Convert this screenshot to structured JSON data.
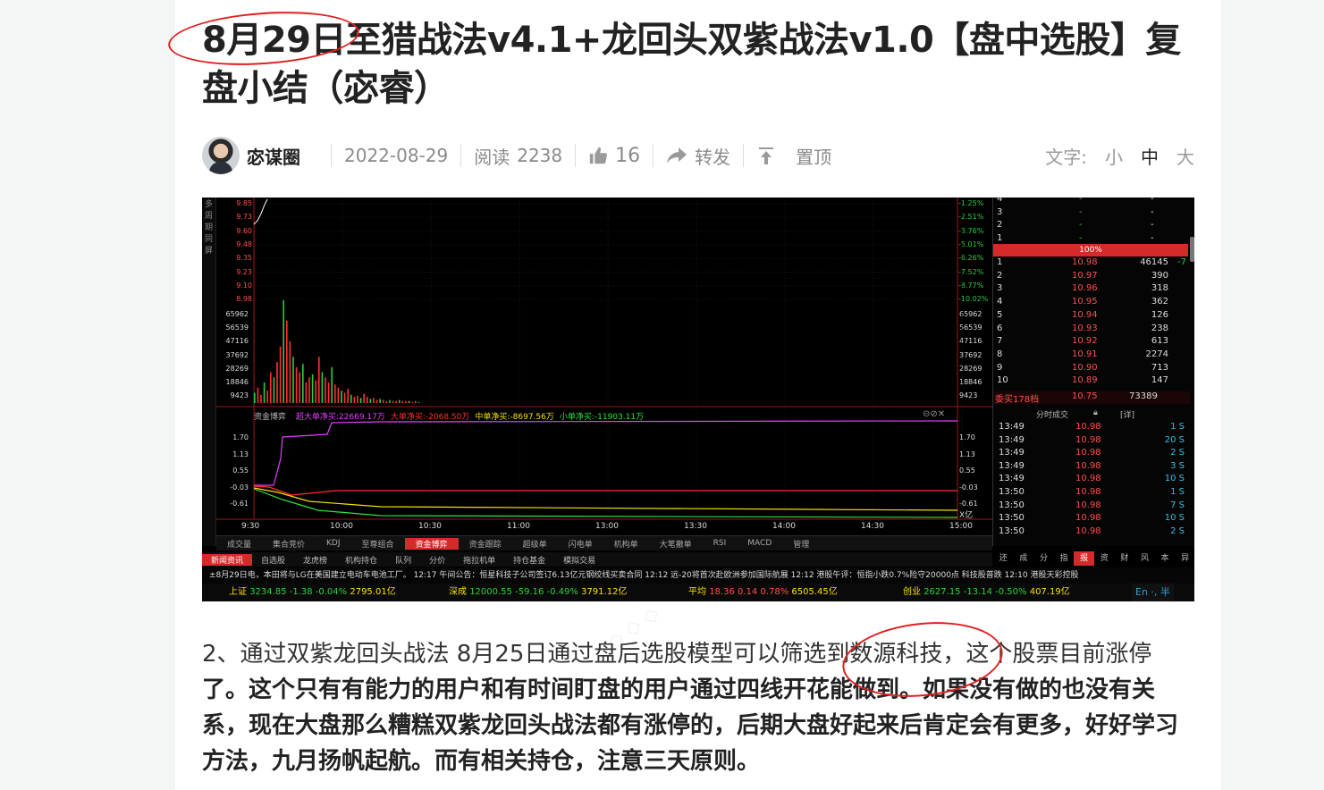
{
  "article": {
    "title": "8月29日至猎战法v4.1+龙回头双紫战法v1.0【盘中选股】复盘小结（宓睿）",
    "author": "宓谋圈",
    "date": "2022-08-29",
    "read_label": "阅读",
    "read_count": "2238",
    "like_count": "16",
    "share_label": "转发",
    "pin_label": "置顶",
    "font_label": "文字:",
    "font_small": "小",
    "font_medium": "中",
    "font_large": "大",
    "para_normal": "2、通过双紫龙回头战法 8月25日通过盘后选股模型可以筛选到数源科技，这个股票目前涨停",
    "para_bold": "了。这个只有有能力的用户和有时间盯盘的用户通过四线开花能做到。如果没有做的也没有关系，现在大盘那么糟糕双紫龙回头战法都有涨停的，后期大盘好起来后肯定会有更多，好好学习方法，九月扬帆起航。而有相关持仓，注意三天原则。"
  },
  "chart": {
    "sidebar_text": "多周期同屏",
    "price_labels": [
      "9.85",
      "9.73",
      "9.60",
      "9.48",
      "9.35",
      "9.23",
      "9.10",
      "8.98"
    ],
    "pct_labels": [
      "-1.25%",
      "-2.51%",
      "-3.76%",
      "-5.01%",
      "-6.26%",
      "-7.52%",
      "-8.77%",
      "-10.02%"
    ],
    "vol_labels": [
      "65962",
      "56539",
      "47116",
      "37692",
      "28269",
      "18846",
      "9423"
    ],
    "fund_panel_title": "资金博弈",
    "fund_legend": [
      {
        "label": "超大单净买:22669.17万",
        "color": "#e040fb"
      },
      {
        "label": "大单净买:-2068.50万",
        "color": "#ff3030"
      },
      {
        "label": "中单净买:-8697.56万",
        "color": "#f5e000"
      },
      {
        "label": "小单净买:-11903.11万",
        "color": "#30e040"
      }
    ],
    "fund_axis": [
      "1.70",
      "1.13",
      "0.55",
      "-0.03",
      "-0.61"
    ],
    "fund_unit": "X亿",
    "time_labels": [
      "9:30",
      "10:00",
      "10:30",
      "11:00",
      "13:00",
      "13:30",
      "14:00",
      "14:30",
      "15:00"
    ],
    "bottom_tabs": [
      "成交量",
      "集合竞价",
      "KDJ",
      "至尊组合",
      "资金博弈",
      "资金跟踪",
      "超级单",
      "闪电单",
      "机构单",
      "大笔撤单",
      "RSI",
      "MACD",
      "管理"
    ],
    "bottom_tab_active": "资金博弈",
    "news_tabs": [
      "新闻资讯",
      "自选股",
      "龙虎榜",
      "机构持仓",
      "队列",
      "分价",
      "拖拉机单",
      "持仓基金",
      "模拟交易"
    ],
    "news_tab_active": "新闻资讯",
    "ticker": "±8月29日电，本田将与LG在美国建立电动车电池工厂。     12:17 午间公告：恒星科技子公司签订6.13亿元钢绞线买卖合同     12:12 远-20将首次赴欧洲参加国际航展     12:12 港股午评：恒指小跌0.7%险守20000点 科技股普跌     12:10 港股天彩控股",
    "indices": [
      {
        "name": "上证",
        "value": "3234.85",
        "chg": "-1.38",
        "pct": "-0.04%",
        "amt": "2795.01亿"
      },
      {
        "name": "深成",
        "value": "12000.55",
        "chg": "-59.16",
        "pct": "-0.49%",
        "amt": "3791.12亿"
      },
      {
        "name": "平均",
        "value": "18.36",
        "chg": "0.14",
        "pct": "0.78%",
        "amt": "6505.45亿"
      },
      {
        "name": "创业",
        "value": "2627.15",
        "chg": "-13.14",
        "pct": "-0.50%",
        "amt": "407.19亿"
      }
    ],
    "ime_status": "En ·, 半",
    "order_book_top": [
      {
        "lvl": "4",
        "price": "-",
        "vol": "-"
      },
      {
        "lvl": "3",
        "price": "-",
        "vol": "-"
      },
      {
        "lvl": "2",
        "price": "-",
        "vol": "-"
      },
      {
        "lvl": "1",
        "price": "-",
        "vol": "-"
      }
    ],
    "ratio_label": "100%",
    "bids": [
      {
        "lvl": "1",
        "price": "10.98",
        "vol": "46145",
        "extra": "-7"
      },
      {
        "lvl": "2",
        "price": "10.97",
        "vol": "390",
        "extra": ""
      },
      {
        "lvl": "3",
        "price": "10.96",
        "vol": "318",
        "extra": ""
      },
      {
        "lvl": "4",
        "price": "10.95",
        "vol": "362",
        "extra": ""
      },
      {
        "lvl": "5",
        "price": "10.94",
        "vol": "126",
        "extra": ""
      },
      {
        "lvl": "6",
        "price": "10.93",
        "vol": "238",
        "extra": ""
      },
      {
        "lvl": "7",
        "price": "10.92",
        "vol": "613",
        "extra": ""
      },
      {
        "lvl": "8",
        "price": "10.91",
        "vol": "2274",
        "extra": ""
      },
      {
        "lvl": "9",
        "price": "10.90",
        "vol": "713",
        "extra": ""
      },
      {
        "lvl": "10",
        "price": "10.89",
        "vol": "147",
        "extra": ""
      }
    ],
    "bid_total_label": "委买178档",
    "bid_total_price": "10.75",
    "bid_total_vol": "73389",
    "ticks_title": "分时成交",
    "ticks_detail": "[详]",
    "ticks": [
      {
        "t": "13:49",
        "p": "10.98",
        "v": "1 S"
      },
      {
        "t": "13:49",
        "p": "10.98",
        "v": "20 S"
      },
      {
        "t": "13:49",
        "p": "10.98",
        "v": "2 S"
      },
      {
        "t": "13:49",
        "p": "10.98",
        "v": "3 S"
      },
      {
        "t": "13:49",
        "p": "10.98",
        "v": "10 S"
      },
      {
        "t": "13:50",
        "p": "10.98",
        "v": "1 S"
      },
      {
        "t": "13:50",
        "p": "10.98",
        "v": "7 S"
      },
      {
        "t": "13:50",
        "p": "10.98",
        "v": "10 S"
      },
      {
        "t": "13:50",
        "p": "10.98",
        "v": "2 S"
      }
    ],
    "right_tabs": [
      "还",
      "成",
      "分",
      "指",
      "报",
      "资",
      "财",
      "风",
      "本",
      "异"
    ],
    "right_tab_active": "报"
  }
}
